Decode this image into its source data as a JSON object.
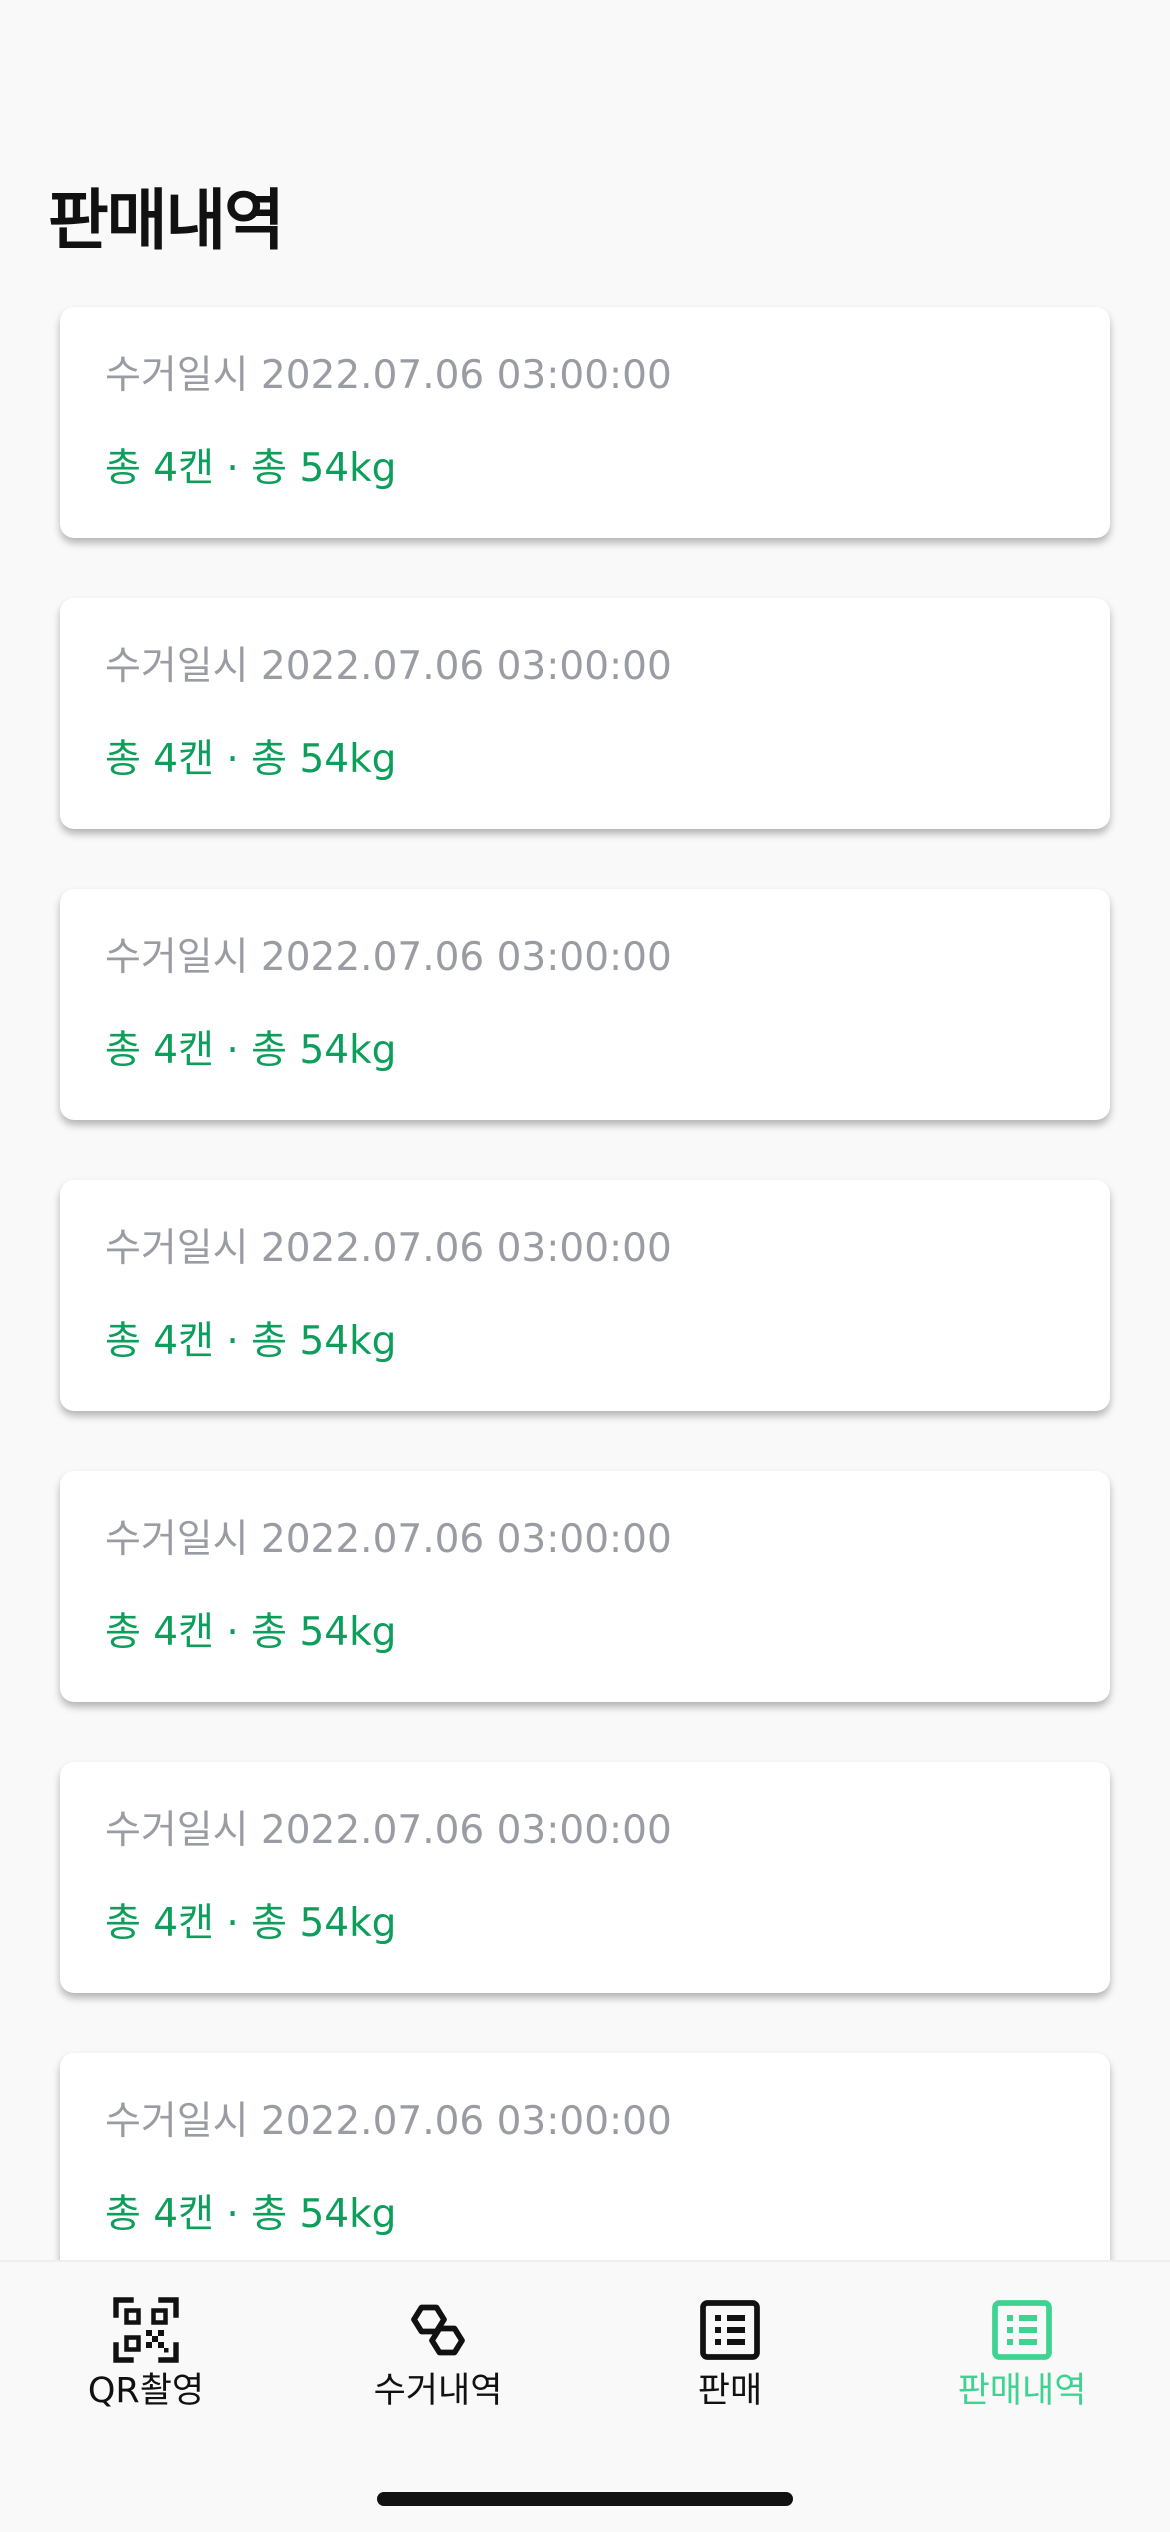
{
  "header": {
    "title": "판매내역"
  },
  "records": [
    {
      "date_label": "수거일시 2022.07.06 03:00:00",
      "summary": "총 4캔 · 총 54kg"
    },
    {
      "date_label": "수거일시 2022.07.06 03:00:00",
      "summary": "총 4캔 · 총 54kg"
    },
    {
      "date_label": "수거일시 2022.07.06 03:00:00",
      "summary": "총 4캔 · 총 54kg"
    },
    {
      "date_label": "수거일시 2022.07.06 03:00:00",
      "summary": "총 4캔 · 총 54kg"
    },
    {
      "date_label": "수거일시 2022.07.06 03:00:00",
      "summary": "총 4캔 · 총 54kg"
    },
    {
      "date_label": "수거일시 2022.07.06 03:00:00",
      "summary": "총 4캔 · 총 54kg"
    },
    {
      "date_label": "수거일시 2022.07.06 03:00:00",
      "summary": "총 4캔 · 총 54kg"
    }
  ],
  "tabbar": {
    "items": [
      {
        "label": "QR촬영",
        "icon": "qr-code-icon",
        "active": false
      },
      {
        "label": "수거내역",
        "icon": "collection-history-icon",
        "active": false
      },
      {
        "label": "판매",
        "icon": "list-icon",
        "active": false
      },
      {
        "label": "판매내역",
        "icon": "list-icon",
        "active": true
      }
    ]
  },
  "colors": {
    "accent": "#3fd392",
    "summary_text": "#0c9e5a",
    "muted_text": "#9a9ca3",
    "background": "#f9f9f9"
  }
}
